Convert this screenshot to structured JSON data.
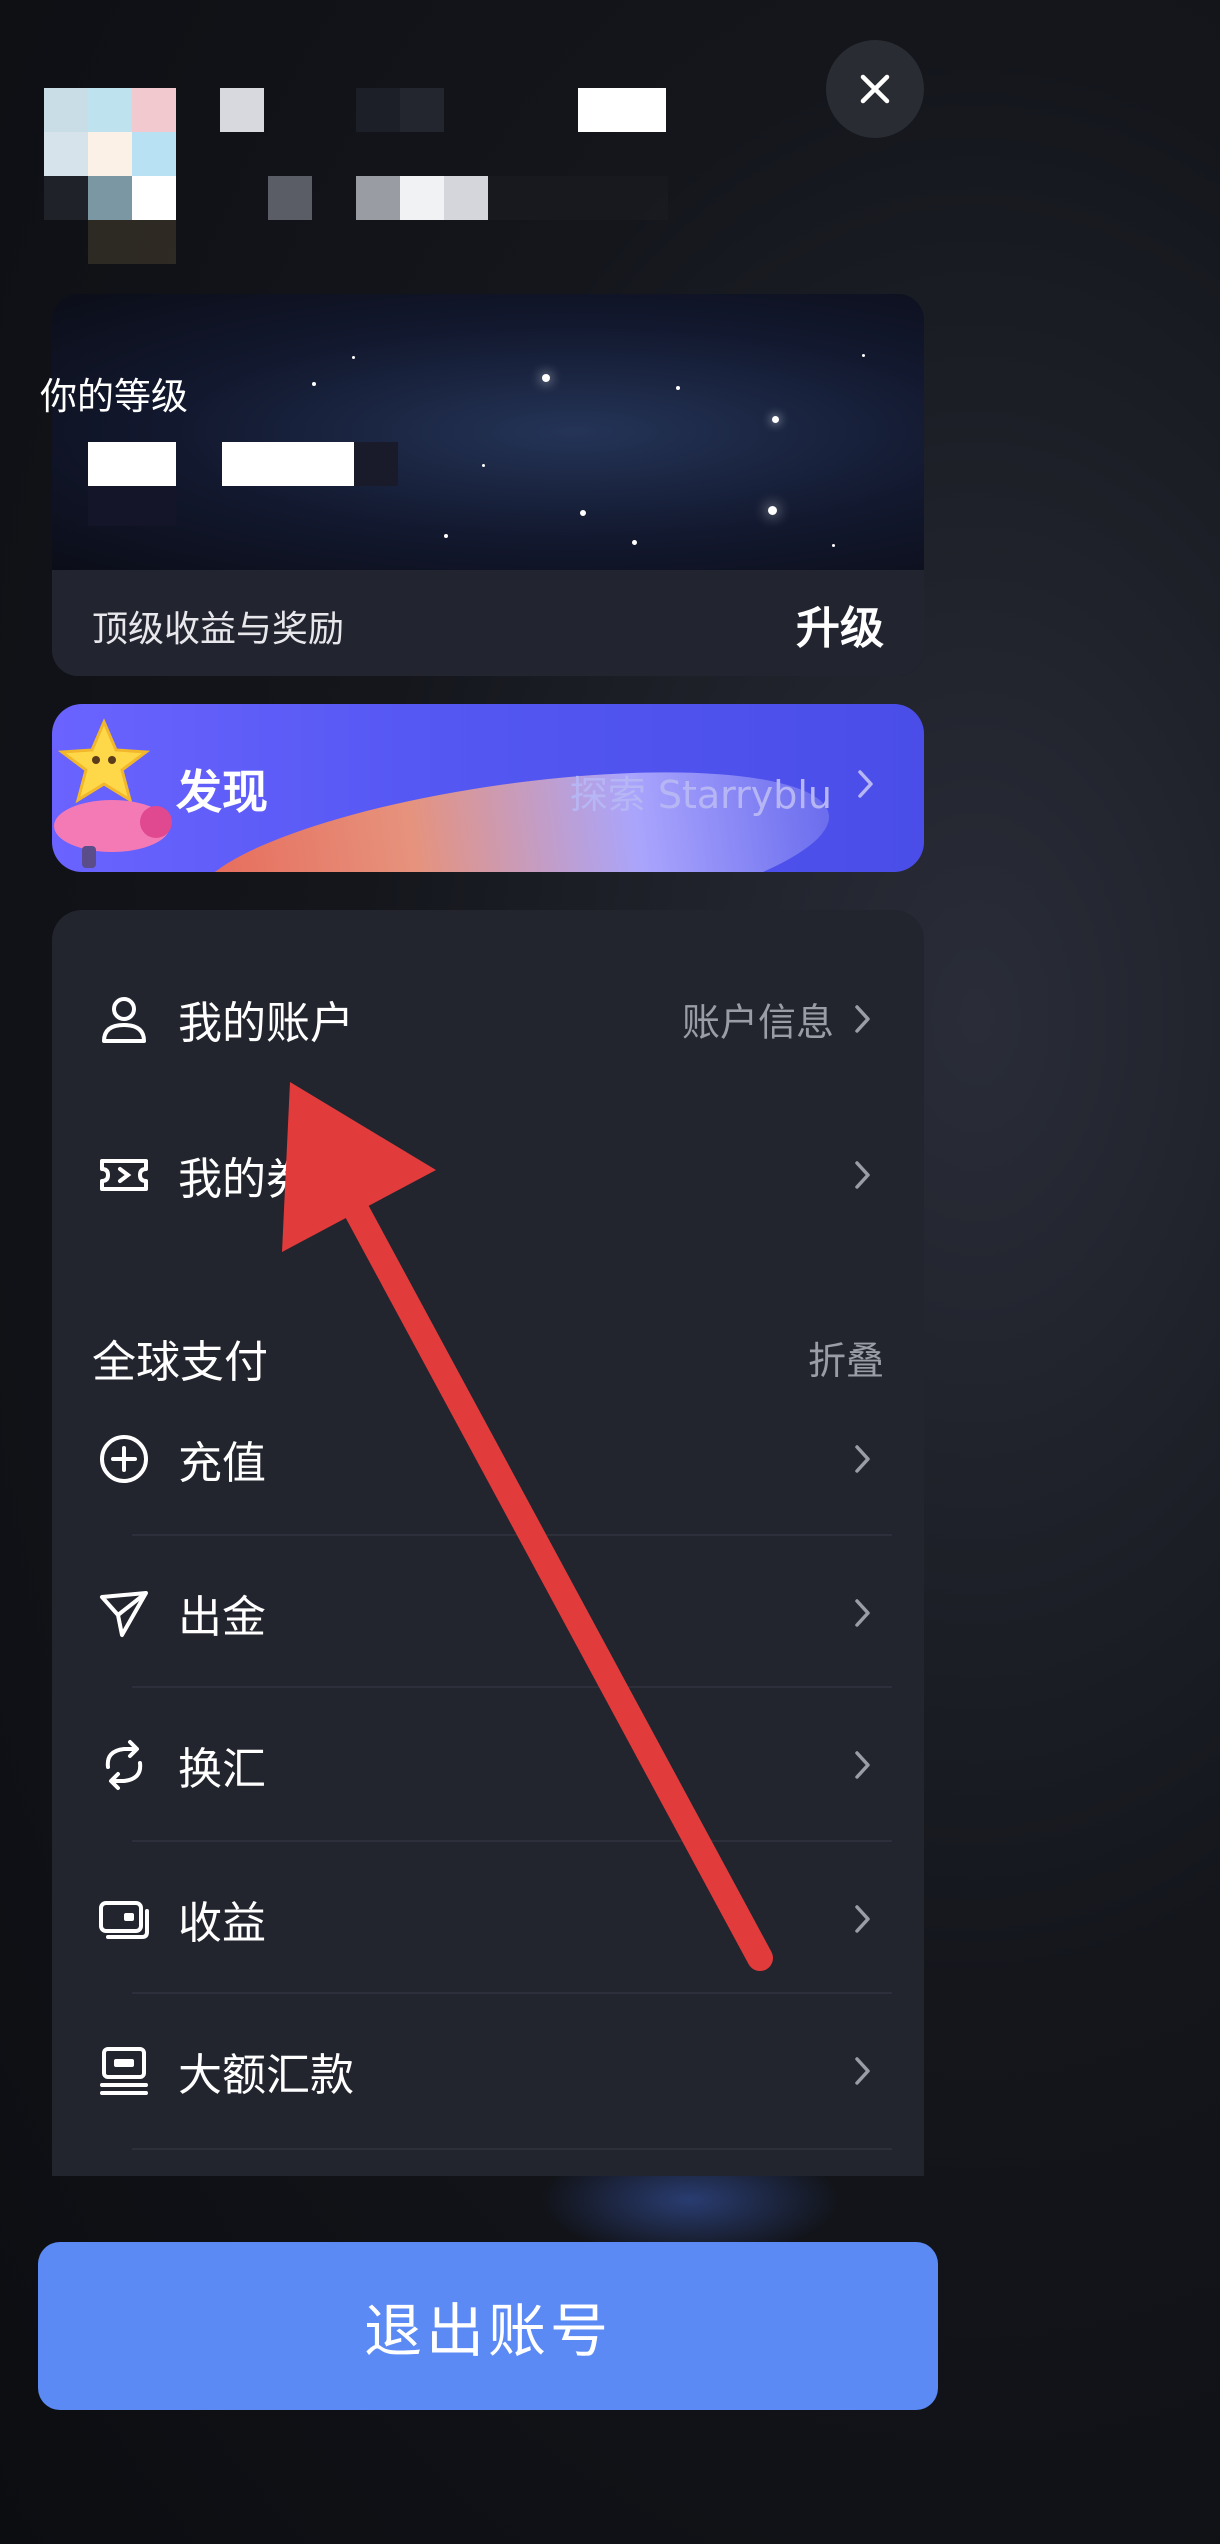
{
  "level": {
    "label": "你的等级",
    "benefit": "顶级收益与奖励",
    "upgrade": "升级"
  },
  "discover": {
    "title": "发现",
    "subtitle": "探索 Starryblu"
  },
  "menu": {
    "account": {
      "label": "我的账户",
      "sub": "账户信息",
      "icon": "user-icon"
    },
    "coupon": {
      "label": "我的券",
      "icon": "ticket-icon"
    },
    "global_pay": {
      "title": "全球支付",
      "action": "折叠"
    },
    "items": [
      {
        "label": "充值",
        "icon": "plus-circle-icon"
      },
      {
        "label": "出金",
        "icon": "send-icon"
      },
      {
        "label": "换汇",
        "icon": "exchange-icon"
      },
      {
        "label": "收益",
        "icon": "earnings-icon"
      },
      {
        "label": "大额汇款",
        "icon": "bank-transfer-icon"
      }
    ]
  },
  "logout": {
    "label": "退出账号"
  },
  "colors": {
    "menu_bg": "#22242e",
    "discover_bg": "#5457f2",
    "logout_bg": "#5b8af5",
    "annotation_arrow": "#e23b3b"
  }
}
